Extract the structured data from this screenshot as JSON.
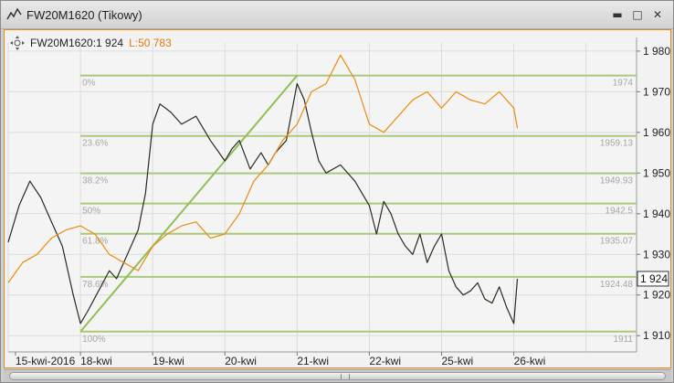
{
  "window": {
    "title": "FW20M1620 (Tikowy)"
  },
  "legend": {
    "symbol_label": "FW20M1620:1 924",
    "l_label": "L:50 783"
  },
  "colors": {
    "accent": "#e58a1c",
    "price_line": "#2a2a20",
    "volume_line": "#ee8a10",
    "fib_line": "#a9c97a",
    "trend_line": "#8fbf55"
  },
  "chart_data": {
    "type": "line",
    "title": "",
    "xlabel": "",
    "ylabel": "",
    "ylim": [
      1906,
      1982
    ],
    "yticks": [
      1910,
      1920,
      1930,
      1940,
      1950,
      1960,
      1970,
      1980
    ],
    "ytick_labels": [
      "1 910",
      "1 920",
      "1 930",
      "1 940",
      "1 950",
      "1 960",
      "1 970",
      "1 980"
    ],
    "x_range": [
      0,
      8.7
    ],
    "xticks": [
      0,
      1,
      2,
      3,
      4,
      5,
      6,
      7,
      8
    ],
    "xtick_labels": [
      "15-kwi-2016",
      "18-kwi",
      "19-kwi",
      "20-kwi",
      "21-kwi",
      "22-kwi",
      "25-kwi",
      "26-kwi"
    ],
    "xtick_positions": [
      0.1,
      1.0,
      2.0,
      3.0,
      4.0,
      5.0,
      6.0,
      7.0
    ],
    "last_price_label": "1 924",
    "last_price": 1924,
    "fibonacci": {
      "x_start": 1.0,
      "x_end": 8.7,
      "levels": [
        {
          "pct": "0%",
          "value": 1974,
          "value_label": "1974"
        },
        {
          "pct": "23.6%",
          "value": 1959.13,
          "value_label": "1959.13"
        },
        {
          "pct": "38.2%",
          "value": 1949.93,
          "value_label": "1949.93"
        },
        {
          "pct": "50%",
          "value": 1942.5,
          "value_label": "1942.5"
        },
        {
          "pct": "61.8%",
          "value": 1935.07,
          "value_label": "1935.07"
        },
        {
          "pct": "78.6%",
          "value": 1924.48,
          "value_label": "1924.48"
        },
        {
          "pct": "100%",
          "value": 1911,
          "value_label": "1911"
        }
      ]
    },
    "trend_line": {
      "x": [
        1.0,
        4.0
      ],
      "y": [
        1911,
        1974
      ]
    },
    "series": [
      {
        "x": [
          0.0,
          0.15,
          0.3,
          0.45,
          0.6,
          0.75,
          0.9,
          1.0,
          1.1,
          1.25,
          1.4,
          1.5,
          1.6,
          1.7,
          1.8,
          1.9,
          2.0,
          2.1,
          2.25,
          2.4,
          2.6,
          2.8,
          3.0,
          3.1,
          3.2,
          3.35,
          3.5,
          3.6,
          3.7,
          3.85,
          4.0,
          4.1,
          4.2,
          4.3,
          4.4,
          4.6,
          4.8,
          4.9,
          5.0,
          5.1,
          5.2,
          5.3,
          5.4,
          5.5,
          5.6,
          5.7,
          5.8,
          5.9,
          6.0,
          6.1,
          6.2,
          6.3,
          6.4,
          6.5,
          6.6,
          6.7,
          6.8,
          6.9,
          7.0,
          7.05
        ],
        "y": [
          1933,
          1942,
          1948,
          1944,
          1938,
          1932,
          1920,
          1913,
          1916,
          1921,
          1926,
          1924,
          1928,
          1932,
          1936,
          1945,
          1962,
          1967,
          1965,
          1962,
          1964,
          1958,
          1953,
          1956,
          1958,
          1951,
          1955,
          1952,
          1955,
          1958,
          1972,
          1968,
          1960,
          1953,
          1950,
          1952,
          1948,
          1945,
          1942,
          1935,
          1943,
          1940,
          1935,
          1932,
          1930,
          1935,
          1928,
          1932,
          1935,
          1926,
          1922,
          1920,
          1921,
          1923,
          1919,
          1918,
          1922,
          1917,
          1913,
          1924
        ]
      },
      {
        "x": [
          0.0,
          0.2,
          0.4,
          0.6,
          0.8,
          1.0,
          1.2,
          1.4,
          1.6,
          1.8,
          2.0,
          2.2,
          2.4,
          2.6,
          2.8,
          3.0,
          3.2,
          3.4,
          3.6,
          3.8,
          4.0,
          4.2,
          4.4,
          4.6,
          4.8,
          5.0,
          5.2,
          5.4,
          5.6,
          5.8,
          6.0,
          6.2,
          6.4,
          6.6,
          6.8,
          7.0,
          7.05
        ],
        "y": [
          1923,
          1928,
          1930,
          1934,
          1936,
          1937,
          1935,
          1930,
          1928,
          1926,
          1932,
          1935,
          1937,
          1938,
          1934,
          1935,
          1940,
          1948,
          1952,
          1958,
          1962,
          1970,
          1972,
          1979,
          1973,
          1962,
          1960,
          1964,
          1968,
          1970,
          1966,
          1970,
          1968,
          1967,
          1970,
          1966,
          1961
        ]
      }
    ]
  }
}
